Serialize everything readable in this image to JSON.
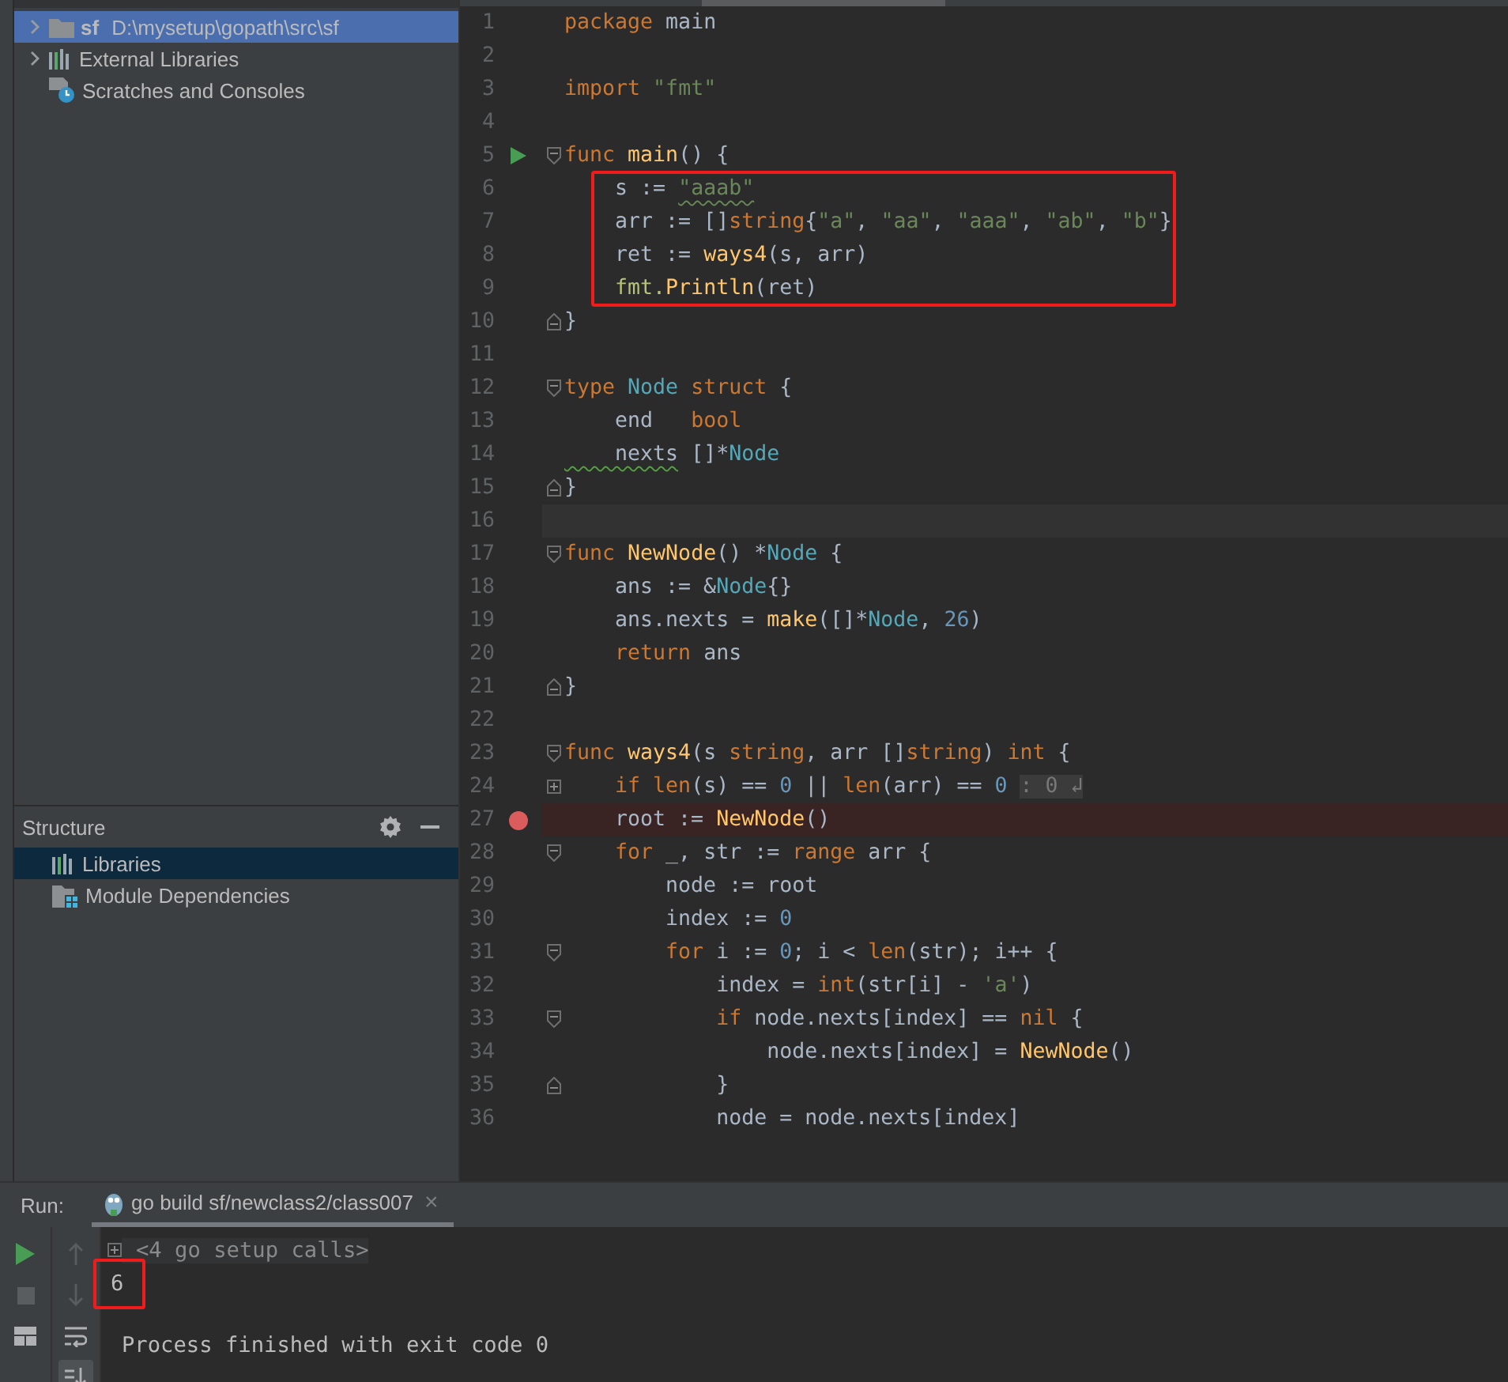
{
  "project_tree": {
    "items": [
      {
        "label": "sf",
        "path": "D:\\mysetup\\gopath\\src\\sf",
        "kind": "folder",
        "expandable": true,
        "selected": true
      },
      {
        "label": "External Libraries",
        "kind": "library",
        "expandable": true,
        "selected": false
      },
      {
        "label": "Scratches and Consoles",
        "kind": "scratch",
        "expandable": false,
        "selected": false
      }
    ]
  },
  "structure": {
    "title": "Structure",
    "items": [
      {
        "label": "Libraries",
        "kind": "library",
        "selected": true
      },
      {
        "label": "Module Dependencies",
        "kind": "module",
        "selected": false
      }
    ]
  },
  "editor": {
    "blocks": [
      {
        "boxed": false,
        "lines": [
          {
            "number": "1",
            "tokens": [
              {
                "text": "package",
                "kind": "kw"
              },
              {
                "text": " main",
                "kind": "plain"
              }
            ]
          },
          {
            "number": "2"
          },
          {
            "number": "3",
            "tokens": [
              {
                "text": "import",
                "kind": "kw"
              },
              {
                "text": " \"fmt\"",
                "kind": "str"
              }
            ]
          },
          {
            "number": "4"
          },
          {
            "number": "5",
            "runnable": true,
            "fold_start": true,
            "tokens": [
              {
                "text": "func",
                "kind": "kw"
              },
              {
                "text": " main",
                "kind": "fn"
              },
              {
                "text": "() {",
                "kind": "plain"
              }
            ]
          }
        ]
      },
      {
        "boxed": true,
        "lines": [
          {
            "number": "6",
            "tokens": [
              {
                "text": "    s := ",
                "kind": "plain"
              },
              {
                "text": "\"aaab\"",
                "kind": "str",
                "squiggle": true
              }
            ]
          },
          {
            "number": "7",
            "tokens": [
              {
                "text": "    arr := []",
                "kind": "plain"
              },
              {
                "text": "string",
                "kind": "kw"
              },
              {
                "text": "{",
                "kind": "plain"
              },
              {
                "text": "\"a\"",
                "kind": "str"
              },
              {
                "text": ", ",
                "kind": "plain"
              },
              {
                "text": "\"aa\"",
                "kind": "str"
              },
              {
                "text": ", ",
                "kind": "plain"
              },
              {
                "text": "\"aaa\"",
                "kind": "str"
              },
              {
                "text": ", ",
                "kind": "plain"
              },
              {
                "text": "\"ab\"",
                "kind": "str"
              },
              {
                "text": ", ",
                "kind": "plain"
              },
              {
                "text": "\"b\"",
                "kind": "str"
              },
              {
                "text": "}",
                "kind": "plain"
              }
            ]
          },
          {
            "number": "8",
            "tokens": [
              {
                "text": "    ret := ",
                "kind": "plain"
              },
              {
                "text": "ways4",
                "kind": "fn"
              },
              {
                "text": "(s, arr)",
                "kind": "plain"
              }
            ]
          },
          {
            "number": "9",
            "tokens": [
              {
                "text": "    fmt.",
                "kind": "pkg"
              },
              {
                "text": "Println",
                "kind": "fn"
              },
              {
                "text": "(ret)",
                "kind": "plain"
              }
            ]
          }
        ]
      },
      {
        "boxed": false,
        "lines": [
          {
            "number": "10",
            "fold_end": true,
            "tokens": [
              {
                "text": "}",
                "kind": "plain"
              }
            ]
          },
          {
            "number": "11"
          },
          {
            "number": "12",
            "fold_start": true,
            "tokens": [
              {
                "text": "type",
                "kind": "kw"
              },
              {
                "text": " Node",
                "kind": "type"
              },
              {
                "text": " struct",
                "kind": "kw"
              },
              {
                "text": " {",
                "kind": "plain"
              }
            ]
          },
          {
            "number": "13",
            "tokens": [
              {
                "text": "    end   ",
                "kind": "plain"
              },
              {
                "text": "bool",
                "kind": "kw"
              }
            ]
          },
          {
            "number": "14",
            "tokens": [
              {
                "text": "    nexts",
                "kind": "plain",
                "squiggle": true
              },
              {
                "text": " []*",
                "kind": "plain"
              },
              {
                "text": "Node",
                "kind": "type"
              }
            ]
          },
          {
            "number": "15",
            "fold_end": true,
            "tokens": [
              {
                "text": "}",
                "kind": "plain"
              }
            ]
          },
          {
            "number": "16",
            "caret": true
          },
          {
            "number": "17",
            "fold_start": true,
            "tokens": [
              {
                "text": "func",
                "kind": "kw"
              },
              {
                "text": " NewNode",
                "kind": "fn"
              },
              {
                "text": "() *",
                "kind": "plain"
              },
              {
                "text": "Node",
                "kind": "type"
              },
              {
                "text": " {",
                "kind": "plain"
              }
            ]
          },
          {
            "number": "18",
            "tokens": [
              {
                "text": "    ans := &",
                "kind": "plain"
              },
              {
                "text": "Node",
                "kind": "type"
              },
              {
                "text": "{}",
                "kind": "plain"
              }
            ]
          },
          {
            "number": "19",
            "tokens": [
              {
                "text": "    ans.nexts = ",
                "kind": "plain"
              },
              {
                "text": "make",
                "kind": "fn"
              },
              {
                "text": "([]*",
                "kind": "plain"
              },
              {
                "text": "Node",
                "kind": "type"
              },
              {
                "text": ", ",
                "kind": "plain"
              },
              {
                "text": "26",
                "kind": "num"
              },
              {
                "text": ")",
                "kind": "plain"
              }
            ]
          },
          {
            "number": "20",
            "tokens": [
              {
                "text": "    return",
                "kind": "kw"
              },
              {
                "text": " ans",
                "kind": "plain"
              }
            ]
          },
          {
            "number": "21",
            "fold_end": true,
            "tokens": [
              {
                "text": "}",
                "kind": "plain"
              }
            ]
          },
          {
            "number": "22"
          },
          {
            "number": "23",
            "fold_start": true,
            "tokens": [
              {
                "text": "func",
                "kind": "kw"
              },
              {
                "text": " ways4",
                "kind": "fn"
              },
              {
                "text": "(s ",
                "kind": "plain"
              },
              {
                "text": "string",
                "kind": "kw"
              },
              {
                "text": ", arr []",
                "kind": "plain"
              },
              {
                "text": "string",
                "kind": "kw"
              },
              {
                "text": ") ",
                "kind": "plain"
              },
              {
                "text": "int",
                "kind": "kw"
              },
              {
                "text": " {",
                "kind": "plain"
              }
            ]
          },
          {
            "number": "24",
            "collapsed": true,
            "tokens": [
              {
                "text": "    if len",
                "kind": "kw"
              },
              {
                "text": "(s) == ",
                "kind": "plain"
              },
              {
                "text": "0",
                "kind": "num"
              },
              {
                "text": " || ",
                "kind": "plain"
              },
              {
                "text": "len",
                "kind": "kw"
              },
              {
                "text": "(arr) == ",
                "kind": "plain"
              },
              {
                "text": "0 ",
                "kind": "num"
              },
              {
                "text": ": 0 ↲",
                "kind": "hint"
              }
            ]
          },
          {
            "number": "27",
            "breakpoint": true,
            "tokens": [
              {
                "text": "    root := ",
                "kind": "plain"
              },
              {
                "text": "NewNode",
                "kind": "fn"
              },
              {
                "text": "()",
                "kind": "plain"
              }
            ]
          },
          {
            "number": "28",
            "fold_start": true,
            "tokens": [
              {
                "text": "    for",
                "kind": "kw"
              },
              {
                "text": " _, str := ",
                "kind": "plain"
              },
              {
                "text": "range",
                "kind": "kw"
              },
              {
                "text": " arr {",
                "kind": "plain"
              }
            ]
          },
          {
            "number": "29",
            "tokens": [
              {
                "text": "        node := root",
                "kind": "plain"
              }
            ]
          },
          {
            "number": "30",
            "tokens": [
              {
                "text": "        index := ",
                "kind": "plain"
              },
              {
                "text": "0",
                "kind": "num"
              }
            ]
          },
          {
            "number": "31",
            "fold_start": true,
            "tokens": [
              {
                "text": "        for",
                "kind": "kw"
              },
              {
                "text": " i := ",
                "kind": "plain"
              },
              {
                "text": "0",
                "kind": "num"
              },
              {
                "text": "; i < ",
                "kind": "plain"
              },
              {
                "text": "len",
                "kind": "kw"
              },
              {
                "text": "(str); i++ {",
                "kind": "plain"
              }
            ]
          },
          {
            "number": "32",
            "tokens": [
              {
                "text": "            index = ",
                "kind": "plain"
              },
              {
                "text": "int",
                "kind": "kw"
              },
              {
                "text": "(str[i] - ",
                "kind": "plain"
              },
              {
                "text": "'a'",
                "kind": "str"
              },
              {
                "text": ")",
                "kind": "plain"
              }
            ]
          },
          {
            "number": "33",
            "fold_start": true,
            "tokens": [
              {
                "text": "            if",
                "kind": "kw"
              },
              {
                "text": " node.nexts[index] == ",
                "kind": "plain"
              },
              {
                "text": "nil",
                "kind": "kw"
              },
              {
                "text": " {",
                "kind": "plain"
              }
            ]
          },
          {
            "number": "34",
            "tokens": [
              {
                "text": "                node.nexts[index] = ",
                "kind": "plain"
              },
              {
                "text": "NewNode",
                "kind": "fn"
              },
              {
                "text": "()",
                "kind": "plain"
              }
            ]
          },
          {
            "number": "35",
            "fold_end": true,
            "tokens": [
              {
                "text": "            }",
                "kind": "plain"
              }
            ]
          },
          {
            "number": "36",
            "tokens": [
              {
                "text": "            node = node.nexts[index]",
                "kind": "plain"
              }
            ]
          }
        ]
      }
    ]
  },
  "run": {
    "label": "Run:",
    "tab": {
      "title": "go build sf/newclass2/class007",
      "close": "×",
      "selected": true
    },
    "toolbar": [
      {
        "kind": "run",
        "selected": false
      },
      {
        "kind": "stop",
        "selected": false
      },
      {
        "kind": "layout",
        "selected": false
      }
    ],
    "toolbar2": [
      {
        "kind": "up",
        "selected": false
      },
      {
        "kind": "down",
        "selected": false
      },
      {
        "kind": "wrap",
        "selected": false
      },
      {
        "kind": "scroll-end",
        "selected": true
      }
    ],
    "output": [
      {
        "text": "<4 go setup calls>",
        "kind": "folded"
      },
      {
        "text": "6",
        "kind": "result",
        "boxed": true
      },
      {
        "text": "Process finished with exit code 0",
        "kind": "status"
      }
    ]
  }
}
